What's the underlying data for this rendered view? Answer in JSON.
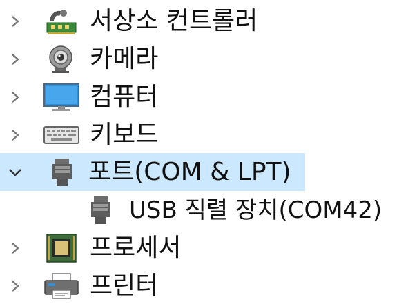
{
  "tree": {
    "items": [
      {
        "label": "서상소 컨트롤러",
        "icon": "sound-controller-icon",
        "expanded": false
      },
      {
        "label": "카메라",
        "icon": "camera-icon",
        "expanded": false
      },
      {
        "label": "컴퓨터",
        "icon": "computer-monitor-icon",
        "expanded": false
      },
      {
        "label": "키보드",
        "icon": "keyboard-icon",
        "expanded": false
      },
      {
        "label": "포트(COM & LPT)",
        "icon": "port-connector-icon",
        "expanded": true,
        "selected": true,
        "children": [
          {
            "label": "USB 직렬 장치(COM42)",
            "icon": "port-connector-icon"
          }
        ]
      },
      {
        "label": "프로세서",
        "icon": "processor-chip-icon",
        "expanded": false
      },
      {
        "label": "프린터",
        "icon": "printer-icon",
        "expanded": false
      }
    ]
  },
  "colors": {
    "selection": "#cce8ff",
    "chevron": "#777777",
    "text": "#111111"
  }
}
